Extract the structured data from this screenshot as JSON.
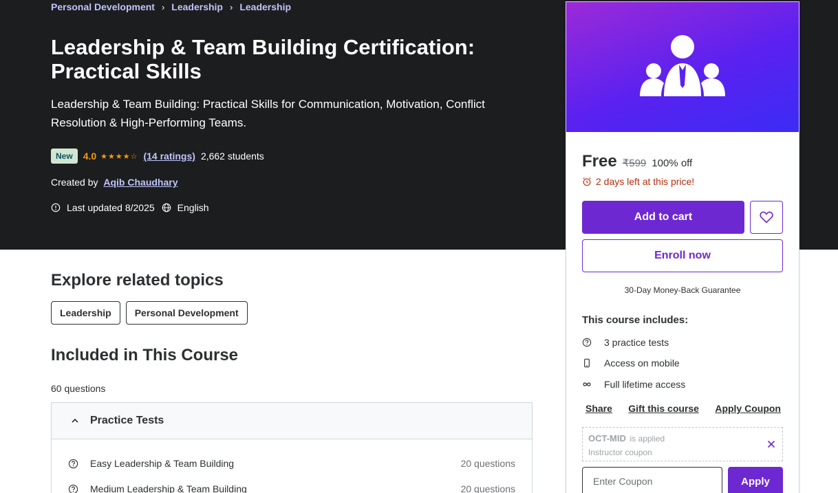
{
  "breadcrumb": [
    "Personal Development",
    "Leadership",
    "Leadership"
  ],
  "course": {
    "title": "Leadership & Team Building Certification: Practical Skills",
    "subtitle": "Leadership & Team Building: Practical Skills for Communication, Motivation, Conflict Resolution & High-Performing Teams.",
    "badge": "New",
    "rating": "4.0",
    "stars": "★★★★☆",
    "ratings_count": "(14 ratings)",
    "students": "2,662 students",
    "created_by_label": "Created by",
    "author": "Aqib Chaudhary",
    "last_updated": "Last updated 8/2025",
    "language": "English"
  },
  "related": {
    "title": "Explore related topics",
    "topics": [
      "Leadership",
      "Personal Development"
    ]
  },
  "included": {
    "title": "Included in This Course",
    "questions": "60 questions",
    "section": "Practice Tests",
    "tests": [
      {
        "name": "Easy Leadership & Team Building",
        "count": "20 questions"
      },
      {
        "name": "Medium Leadership & Team Building",
        "count": "20 questions"
      }
    ]
  },
  "sidebar": {
    "price": "Free",
    "original_price": "₹599",
    "discount": "100% off",
    "deadline": "2 days left at this price!",
    "add_to_cart": "Add to cart",
    "enroll": "Enroll now",
    "guarantee": "30-Day Money-Back Guarantee",
    "includes_title": "This course includes:",
    "includes": [
      {
        "icon": "help-circle-icon",
        "label": "3 practice tests"
      },
      {
        "icon": "mobile-icon",
        "label": "Access on mobile"
      },
      {
        "icon": "infinity-icon",
        "label": "Full lifetime access"
      }
    ],
    "links": [
      "Share",
      "Gift this course",
      "Apply Coupon"
    ],
    "coupon": {
      "code": "OCT-MID",
      "status": "is applied",
      "type": "Instructor coupon"
    },
    "coupon_placeholder": "Enter Coupon",
    "apply": "Apply"
  },
  "colors": {
    "hero_bg": "#1c1d1f",
    "accent": "#6d28d2",
    "link": "#c0c4fc",
    "star": "#f69c08",
    "alert": "#b32d0f"
  }
}
